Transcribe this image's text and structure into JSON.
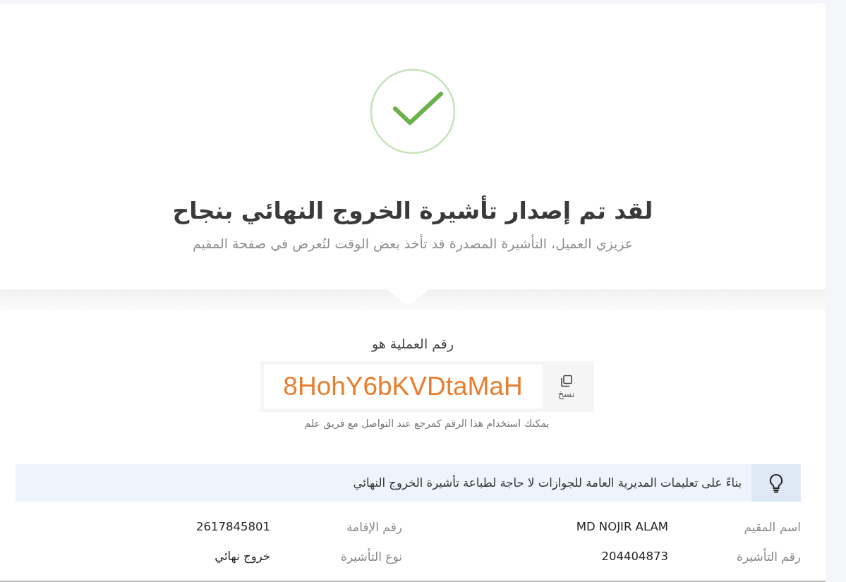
{
  "title": "لقد تم إصدار تأشيرة الخروج النهائي بنجاح",
  "subtitle": "عزيزي العميل، التأشيرة المصدرة قد تأخذ بعض الوقت لتُعرض في صفحة المقيم",
  "transaction": {
    "label": "رقم العملية هو",
    "code": "8HohY6bKVDtaMaH",
    "copy_label": "نسخ",
    "hint": "يمكنك استخدام هذا الرقم كمرجع عند التواصل مع فريق علم"
  },
  "notice": "بناءً على تعليمات المديرية العامة للجوازات لا حاجة لطباعة تأشيرة الخروج النهائي",
  "details": [
    {
      "label": "اسم المقيم",
      "value": "MD NOJIR ALAM"
    },
    {
      "label": "رقم الإقامة",
      "value": "2617845801"
    },
    {
      "label": "رقم التأشيرة",
      "value": "204404873"
    },
    {
      "label": "نوع التأشيرة",
      "value": "خروج نهائي"
    }
  ]
}
